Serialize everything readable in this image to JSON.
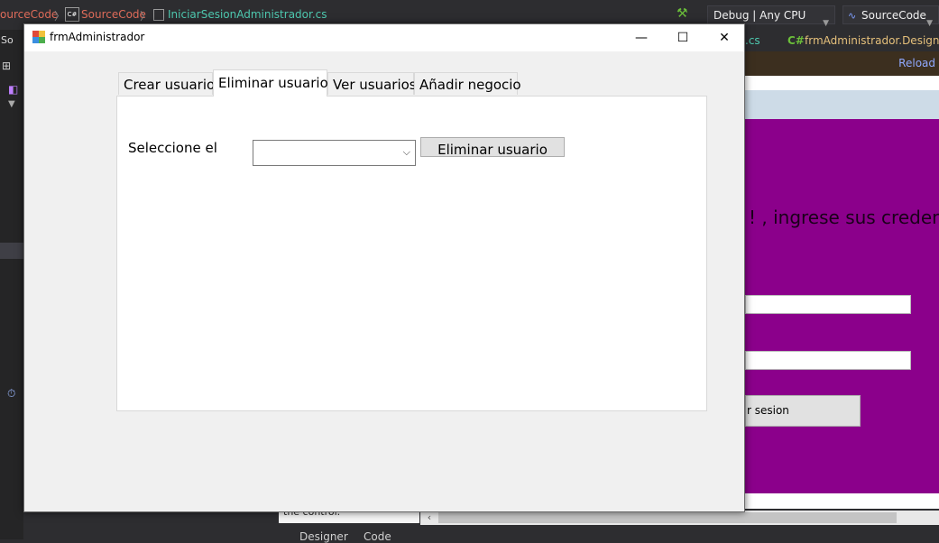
{
  "ide": {
    "breadcrumb": [
      "ourceCode",
      "SourceCode",
      "IniciarSesionAdministrador.cs"
    ],
    "breadcrumb_icon_label": "C#",
    "config": "Debug | Any CPU",
    "project": "SourceCode",
    "left_tab_fragment": "So",
    "doc_tabs": [
      ".cs",
      "C#",
      "frmAdministrador.Designer.c"
    ],
    "reload_label": "Reload",
    "designer_text": "! , ingrese sus credencia",
    "designer_button": "r sesion",
    "hint_text": "the control.",
    "bottom_tabs": [
      "Designer",
      "Code"
    ]
  },
  "dialog": {
    "title": "frmAdministrador",
    "minimize_glyph": "—",
    "maximize_glyph": "☐",
    "close_glyph": "✕"
  },
  "tabs": [
    {
      "label": "Crear usuario",
      "active": false
    },
    {
      "label": "Eliminar usuario",
      "active": true
    },
    {
      "label": "Ver usuarios",
      "active": false
    },
    {
      "label": "Añadir negocio",
      "active": false
    }
  ],
  "panel": {
    "select_label": "Seleccione el",
    "combo_value": "",
    "delete_button": "Eliminar usuario"
  },
  "colors": {
    "ide_bg": "#2d2d30",
    "form_purple": "#8b008b",
    "accent_blue": "#0078d7"
  }
}
